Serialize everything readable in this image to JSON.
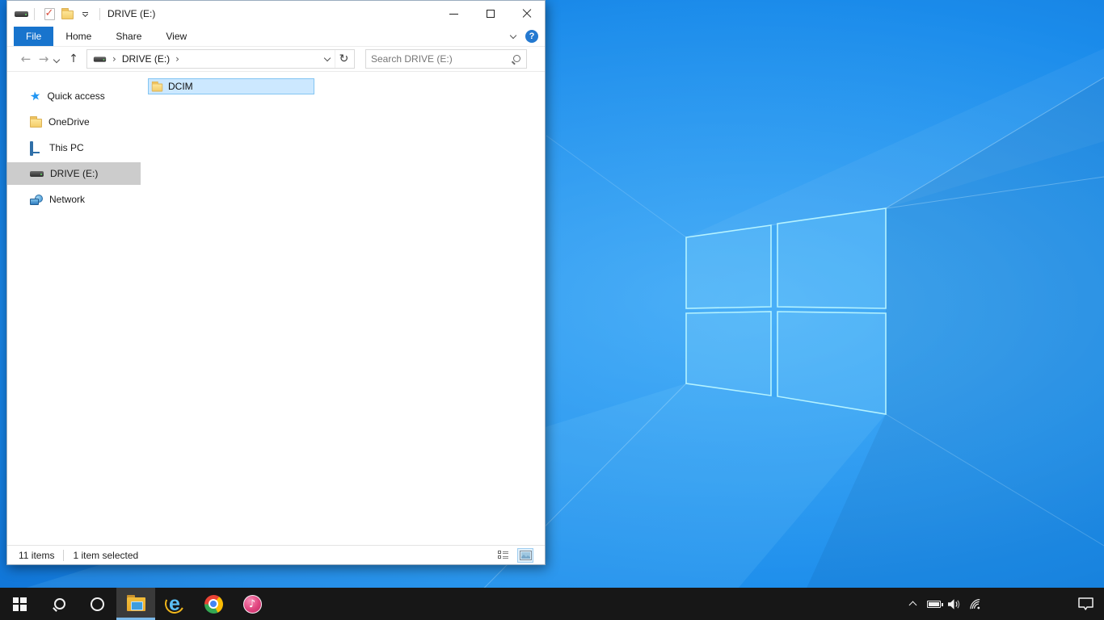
{
  "window": {
    "title": "DRIVE (E:)",
    "quick_access_toolbar_icons": [
      "drive-icon",
      "properties-check-icon",
      "new-folder-icon",
      "customize-toolbar-dropdown-icon"
    ]
  },
  "ribbon": {
    "tabs": [
      {
        "label": "File",
        "active": true
      },
      {
        "label": "Home",
        "active": false
      },
      {
        "label": "Share",
        "active": false
      },
      {
        "label": "View",
        "active": false
      }
    ],
    "help_label": "?"
  },
  "navigation": {
    "breadcrumb": {
      "root_icon": "drive-icon",
      "segment": "DRIVE (E:)"
    },
    "search_placeholder": "Search DRIVE (E:)"
  },
  "sidebar": {
    "items": [
      {
        "label": "Quick access",
        "icon": "quick-access-star-icon",
        "selected": false
      },
      {
        "label": "OneDrive",
        "icon": "onedrive-folder-icon",
        "selected": false
      },
      {
        "label": "This PC",
        "icon": "this-pc-icon",
        "selected": false
      },
      {
        "label": "DRIVE (E:)",
        "icon": "drive-icon",
        "selected": true
      },
      {
        "label": "Network",
        "icon": "network-icon",
        "selected": false
      }
    ]
  },
  "files": [
    {
      "name": "DCIM",
      "icon": "folder-icon",
      "selected": true
    }
  ],
  "status_bar": {
    "items_count": "11 items",
    "selection": "1 item selected",
    "view_toggles": [
      "details-view-icon",
      "large-icons-view-icon"
    ]
  },
  "taskbar": {
    "buttons": [
      {
        "icon": "start-icon",
        "active": false
      },
      {
        "icon": "search-icon",
        "active": false
      },
      {
        "icon": "cortana-icon",
        "active": false
      },
      {
        "icon": "file-explorer-icon",
        "active": true
      },
      {
        "icon": "internet-explorer-icon",
        "active": false
      },
      {
        "icon": "chrome-icon",
        "active": false
      },
      {
        "icon": "itunes-icon",
        "active": false
      }
    ],
    "tray_icons": [
      "tray-expand-chevron-icon",
      "battery-icon",
      "volume-icon",
      "wifi-icon",
      "action-center-icon"
    ]
  },
  "colors": {
    "accent_blue": "#1874cd",
    "file_selection_bg": "#cce8ff",
    "file_selection_border": "#84c5f2",
    "sidebar_selected_bg": "#cccccc",
    "taskbar_bg": "#171717",
    "taskbar_active_underline": "#7ab8e8",
    "wallpaper_center": "#32a5f7",
    "wallpaper_edge": "#0955a7"
  }
}
